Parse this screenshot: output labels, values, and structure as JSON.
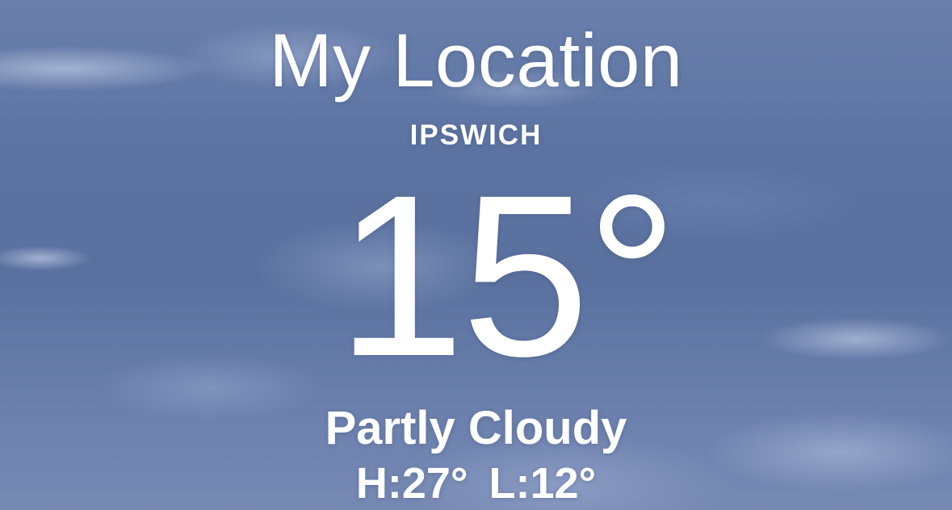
{
  "weather": {
    "title": "My Location",
    "location": "IPSWICH",
    "temperature": "15°",
    "condition": "Partly Cloudy",
    "high": "H:27°",
    "low": "L:12°"
  },
  "colors": {
    "sky": "#5c73a2",
    "text": "#ffffff"
  }
}
